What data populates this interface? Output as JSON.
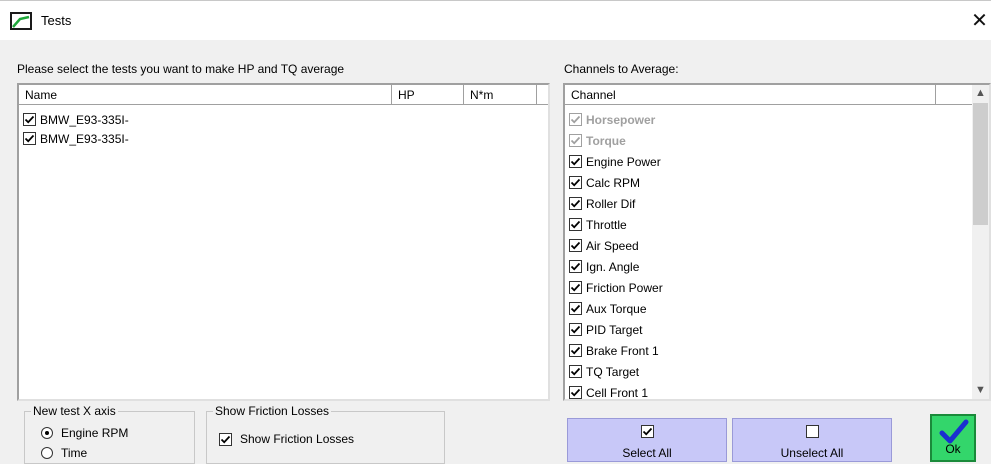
{
  "window": {
    "title": "Tests",
    "close_glyph": "✕"
  },
  "tests_prompt": "Please select the tests you want to make HP and TQ average",
  "tests_table": {
    "columns": [
      "Name",
      "HP",
      "N*m"
    ],
    "rows": [
      {
        "name": "BMW_E93-335I-",
        "checked": true
      },
      {
        "name": "BMW_E93-335I-",
        "checked": true
      }
    ]
  },
  "channels_label": "Channels to Average:",
  "channels_table": {
    "column": "Channel",
    "rows": [
      {
        "label": "Horsepower",
        "checked": true,
        "disabled": true
      },
      {
        "label": "Torque",
        "checked": true,
        "disabled": true
      },
      {
        "label": "Engine Power",
        "checked": true,
        "disabled": false
      },
      {
        "label": "Calc RPM",
        "checked": true,
        "disabled": false
      },
      {
        "label": "Roller Dif",
        "checked": true,
        "disabled": false
      },
      {
        "label": "Throttle",
        "checked": true,
        "disabled": false
      },
      {
        "label": "Air Speed",
        "checked": true,
        "disabled": false
      },
      {
        "label": "Ign. Angle",
        "checked": true,
        "disabled": false
      },
      {
        "label": "Friction Power",
        "checked": true,
        "disabled": false
      },
      {
        "label": "Aux Torque",
        "checked": true,
        "disabled": false
      },
      {
        "label": "PID Target",
        "checked": true,
        "disabled": false
      },
      {
        "label": "Brake Front 1",
        "checked": true,
        "disabled": false
      },
      {
        "label": "TQ Target",
        "checked": true,
        "disabled": false
      },
      {
        "label": "Cell Front 1",
        "checked": true,
        "disabled": false
      }
    ]
  },
  "x_axis_group": {
    "title": "New test X axis",
    "options": [
      {
        "label": "Engine RPM",
        "selected": true
      },
      {
        "label": "Time",
        "selected": false
      }
    ]
  },
  "friction_group": {
    "title": "Show Friction Losses",
    "checkbox_label": "Show Friction Losses",
    "checked": true
  },
  "buttons": {
    "select_all": "Select All",
    "unselect_all": "Unselect All",
    "ok": "Ok"
  },
  "colors": {
    "button_bg": "#c8c8f8",
    "ok_bg": "#33d66b",
    "disabled_text": "#a0a0a0"
  }
}
